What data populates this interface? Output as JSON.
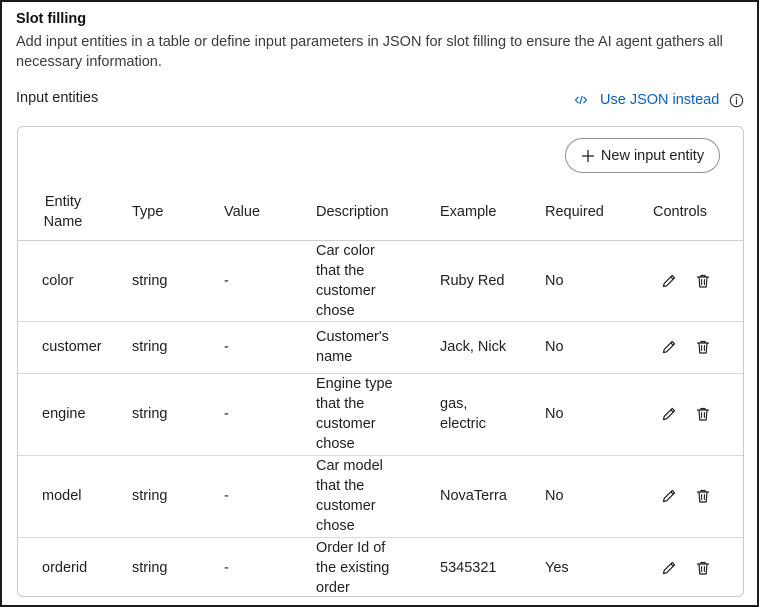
{
  "section": {
    "title": "Slot filling",
    "description": "Add input entities in a table or define input parameters in JSON for slot filling to ensure the AI agent gathers all necessary information.",
    "input_label": "Input entities",
    "json_link_label": "Use JSON instead",
    "json_link_icon": "code-icon",
    "info_icon": "info-icon"
  },
  "table": {
    "new_button_label": "New input entity",
    "columns": [
      "Entity Name",
      "Type",
      "Value",
      "Description",
      "Example",
      "Required",
      "Controls"
    ],
    "rows": [
      {
        "name": "color",
        "type": "string",
        "value": "-",
        "description": "Car color that the customer chose",
        "example": "Ruby Red",
        "required": "No"
      },
      {
        "name": "customer",
        "type": "string",
        "value": "-",
        "description": "Customer's name",
        "example": "Jack, Nick",
        "required": "No"
      },
      {
        "name": "engine",
        "type": "string",
        "value": "-",
        "description": "Engine type that the customer chose",
        "example": "gas, electric",
        "required": "No"
      },
      {
        "name": "model",
        "type": "string",
        "value": "-",
        "description": "Car model that the customer chose",
        "example": "NovaTerra",
        "required": "No"
      },
      {
        "name": "orderid",
        "type": "string",
        "value": "-",
        "description": "Order Id of the existing order",
        "example": "5345321",
        "required": "Yes"
      }
    ],
    "control_icons": [
      "pencil-icon",
      "trash-icon"
    ]
  },
  "colors": {
    "link": "#0a60c2",
    "border": "#c9c9c9",
    "text": "#1f1f1f",
    "muted_text": "#3b3b3b"
  }
}
